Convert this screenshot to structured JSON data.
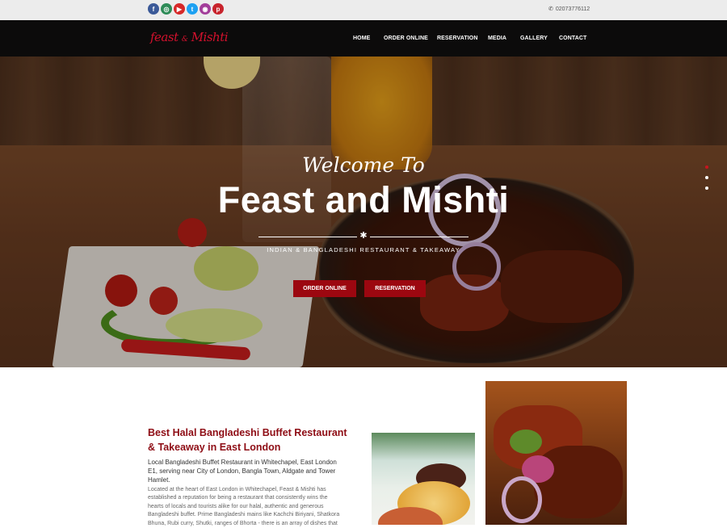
{
  "topbar": {
    "socials": [
      {
        "icon": "facebook-icon",
        "glyph": "f",
        "color": "#3b5998"
      },
      {
        "icon": "tripadvisor-icon",
        "glyph": "◎",
        "color": "#2e8b57"
      },
      {
        "icon": "youtube-icon",
        "glyph": "▶",
        "color": "#d62828"
      },
      {
        "icon": "twitter-icon",
        "glyph": "t",
        "color": "#1da1f2"
      },
      {
        "icon": "instagram-icon",
        "glyph": "◉",
        "color": "#a23d9a"
      },
      {
        "icon": "pinterest-icon",
        "glyph": "p",
        "color": "#c8232c"
      }
    ],
    "phone": "02073776112"
  },
  "nav": {
    "logo_main": "feast",
    "logo_amp": "&",
    "logo_second": "Mishti",
    "items": [
      "HOME",
      "ORDER ONLINE",
      "RESERVATION",
      "MEDIA",
      "GALLERY",
      "CONTACT"
    ]
  },
  "hero": {
    "welcome": "Welcome To",
    "title": "Feast and Mishti",
    "subtitle": "INDIAN & BANGLADESHI RESTAURANT & TAKEAWAY",
    "btn_order": "ORDER ONLINE",
    "btn_reservation": "RESERVATION",
    "active_slide": 1,
    "slides": 3
  },
  "intro": {
    "heading": "Best Halal Bangladeshi Buffet Restaurant & Takeaway in East London",
    "para1": "Local Bangladeshi Buffet Restaurant in Whitechapel, East London E1, serving near City of London, Bangla Town, Aldgate and Tower Hamlet.",
    "para2": "Located at the heart of East London in Whitechapel, Feast & Mishti has established a reputation for being a restaurant that consistently wins the hearts of locals and tourists alike for our halal, authentic and generous Bangladeshi buffet. Prime Bangladeshi mains like Kachchi Biriyani, Shatkora Bhuna, Rubi curry, Shutki, ranges of Bhorta - there is an array of dishes that"
  },
  "colors": {
    "accent": "#9c0710",
    "heading": "#8e0d15",
    "nav_bg": "#0c0b0b",
    "topbar_bg": "#ececec"
  }
}
